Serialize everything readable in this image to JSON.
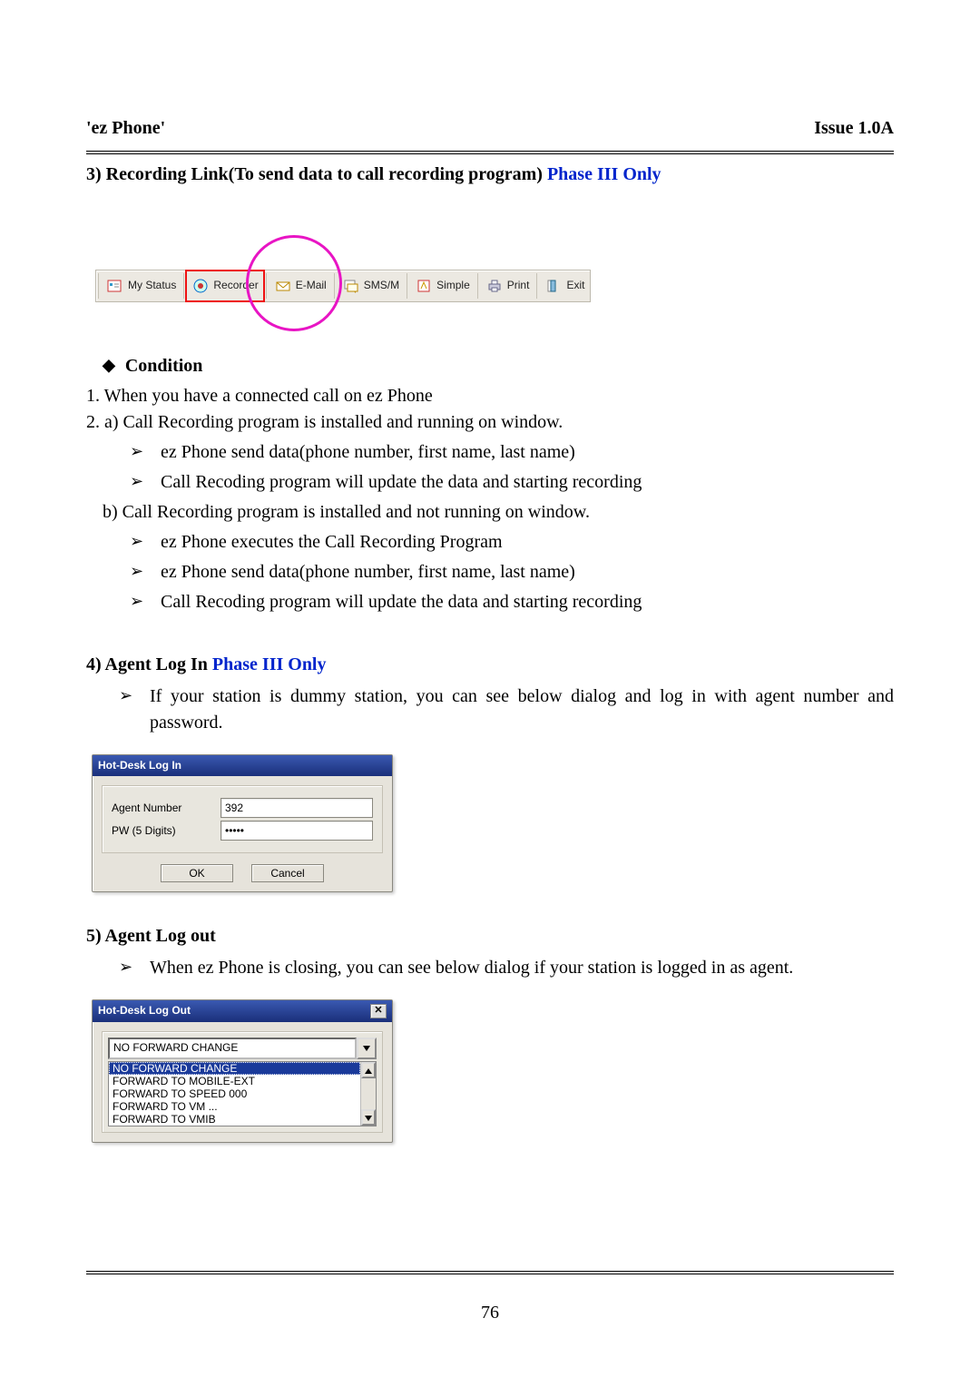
{
  "header": {
    "left": "'ez Phone'",
    "right": "Issue 1.0A"
  },
  "section3": {
    "label_a": "3)  Recording Link(To send data to call recording program) ",
    "label_b": "Phase III Only"
  },
  "toolbar": {
    "items": [
      {
        "label": "My Status",
        "icon": "status-icon"
      },
      {
        "label": "Recorder",
        "icon": "recorder-icon"
      },
      {
        "label": "E-Mail",
        "icon": "email-icon"
      },
      {
        "label": "SMS/M",
        "icon": "sms-icon"
      },
      {
        "label": "Simple",
        "icon": "simple-icon"
      },
      {
        "label": "Print",
        "icon": "print-icon"
      },
      {
        "label": "Exit",
        "icon": "exit-icon"
      }
    ]
  },
  "condition": {
    "heading": "Condition",
    "item1": "1. When you have a connected call on ez Phone",
    "item2": "2. a) Call Recording program is installed and running on window.",
    "item2_a": [
      "ez Phone send data(phone number, first name, last name)",
      "Call Recoding program will update the data and starting recording"
    ],
    "item2b": "b) Call Recording program is installed and not running on window.",
    "item2b_a": [
      "ez Phone executes the Call Recording Program",
      "ez Phone send data(phone number, first name, last name)",
      "Call Recoding program will update the data and starting recording"
    ]
  },
  "section4": {
    "label_a": "4)  Agent Log In ",
    "label_b": "Phase III Only",
    "bullet": "If your station is dummy station, you can see below dialog and log in with agent number and password."
  },
  "loginDialog": {
    "title": "Hot-Desk Log In",
    "agentLabel": "Agent Number",
    "agentValue": "392",
    "pwLabel": "PW (5 Digits)",
    "pwValue": "*****",
    "ok": "OK",
    "cancel": "Cancel"
  },
  "section5": {
    "label": "5)  Agent Log out",
    "bullet": "When ez Phone is closing, you can see below dialog if your station is logged in as agent."
  },
  "logoutDialog": {
    "title": "Hot-Desk Log Out",
    "selected": "NO FORWARD CHANGE",
    "options": [
      "NO FORWARD CHANGE",
      "FORWARD TO MOBILE-EXT",
      "FORWARD TO SPEED 000",
      "FORWARD TO VM ...",
      "FORWARD TO VMIB"
    ]
  },
  "pageNumber": "76"
}
